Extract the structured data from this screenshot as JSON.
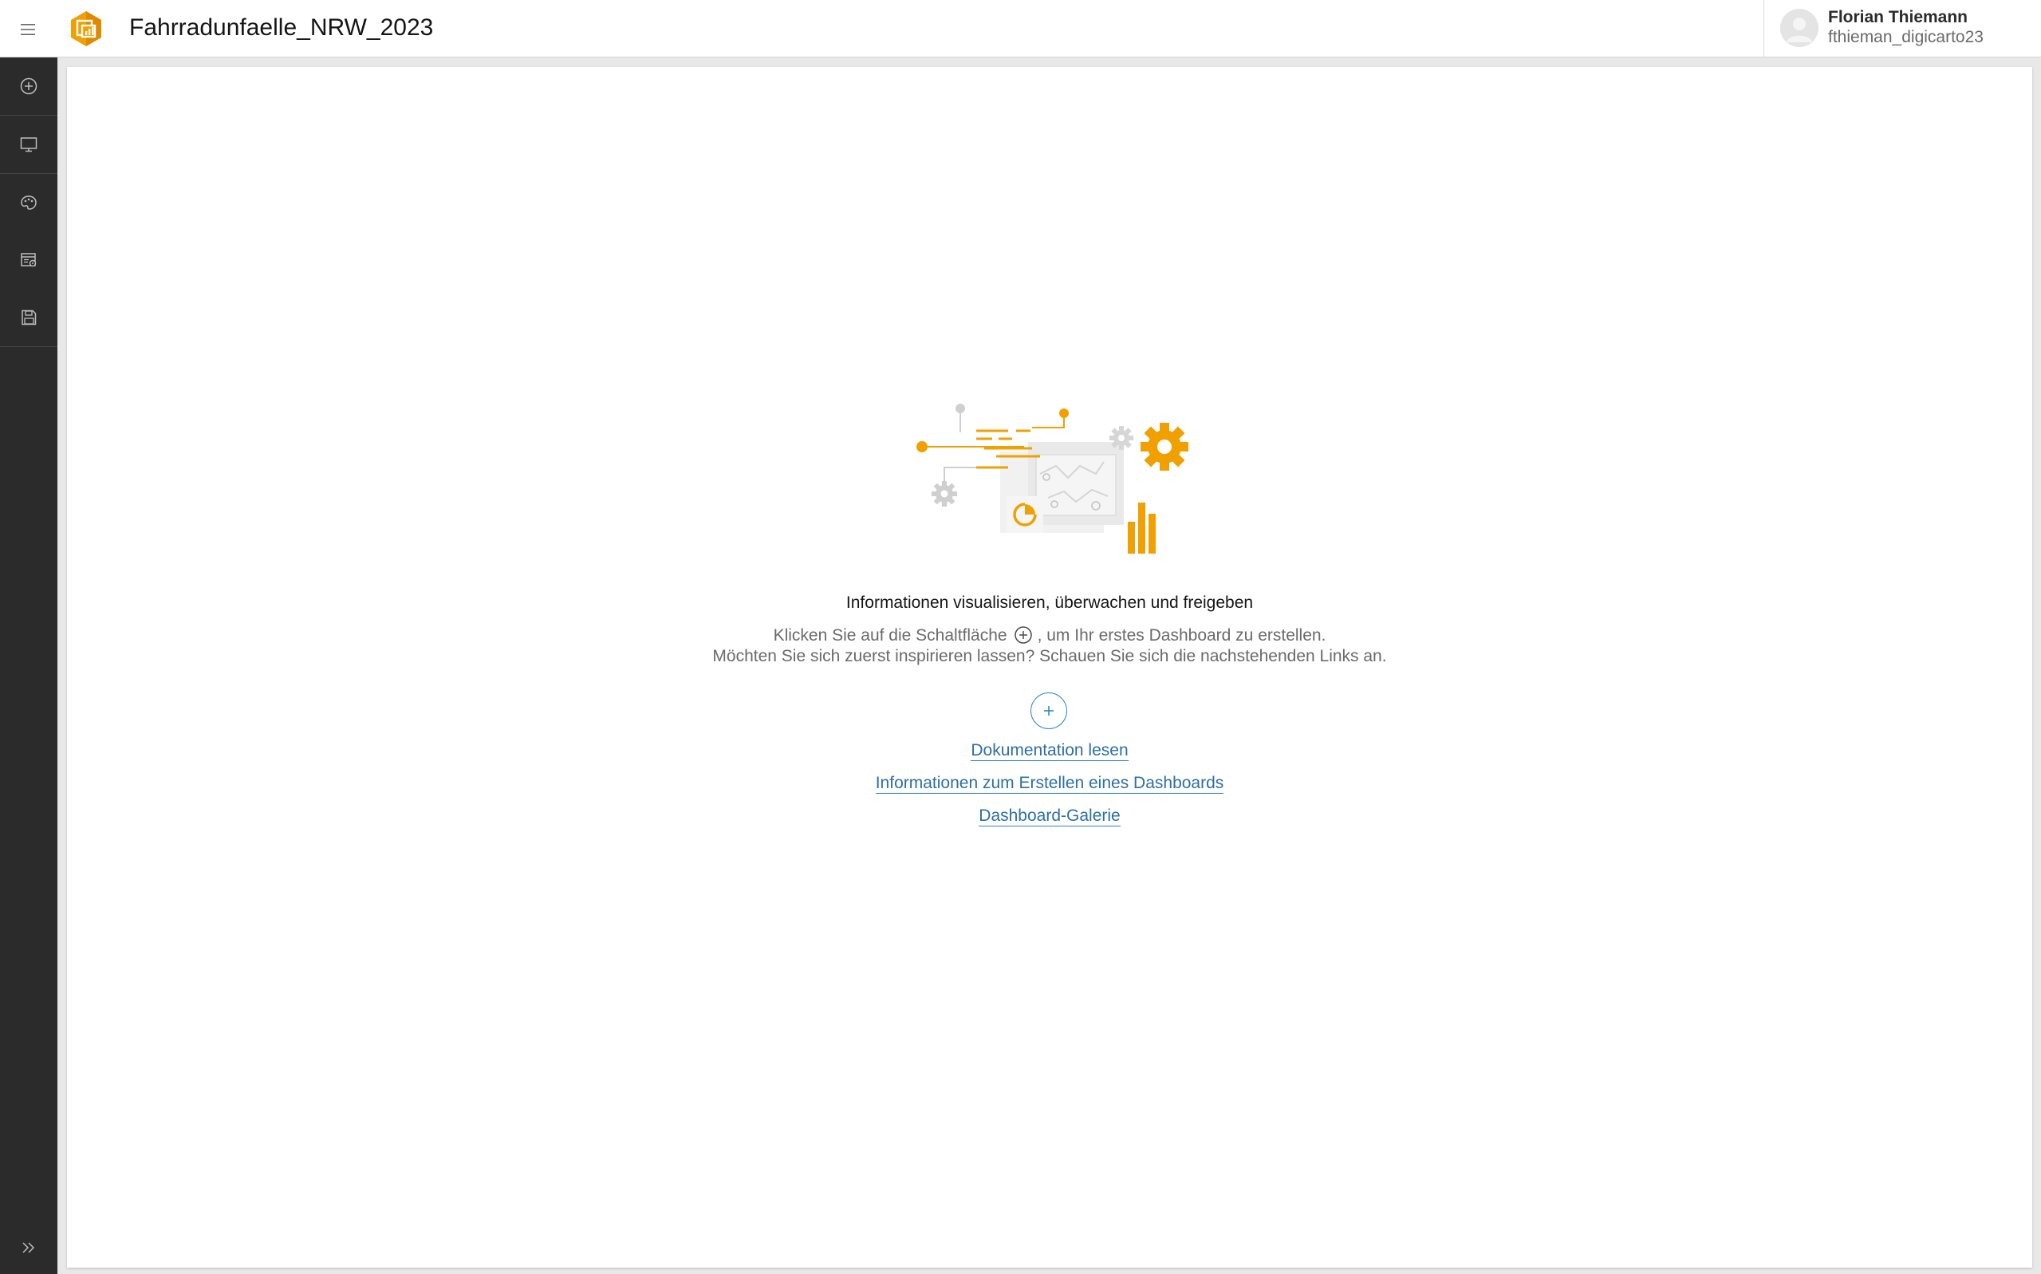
{
  "header": {
    "menu_icon": "hamburger-menu-icon",
    "logo_icon": "dashboards-app-icon",
    "title": "Fahrradunfaelle_NRW_2023",
    "user": {
      "name": "Florian Thiemann",
      "username": "fthieman_digicarto23",
      "avatar_icon": "user-avatar-icon"
    }
  },
  "sidebar": {
    "items": [
      {
        "icon": "add-element-icon"
      },
      {
        "icon": "layout-monitor-icon"
      },
      {
        "icon": "theme-palette-icon"
      },
      {
        "icon": "settings-panel-icon"
      },
      {
        "icon": "save-icon"
      }
    ],
    "expand_icon": "double-chevron-right-icon"
  },
  "empty_state": {
    "heading": "Informationen visualisieren, überwachen und freigeben",
    "line1_before": "Klicken Sie auf die Schaltfläche",
    "line1_after": ", um Ihr erstes Dashboard zu erstellen.",
    "line2": "Möchten Sie sich zuerst inspirieren lassen? Schauen Sie sich die nachstehenden Links an.",
    "links": {
      "docs": "Dokumentation lesen",
      "create_info": "Informationen zum Erstellen eines Dashboards",
      "gallery": "Dashboard-Galerie"
    }
  },
  "colors": {
    "accent_orange": "#f0a000",
    "link_blue": "#2d6fa8",
    "sidebar_bg": "#2b2b2b"
  }
}
